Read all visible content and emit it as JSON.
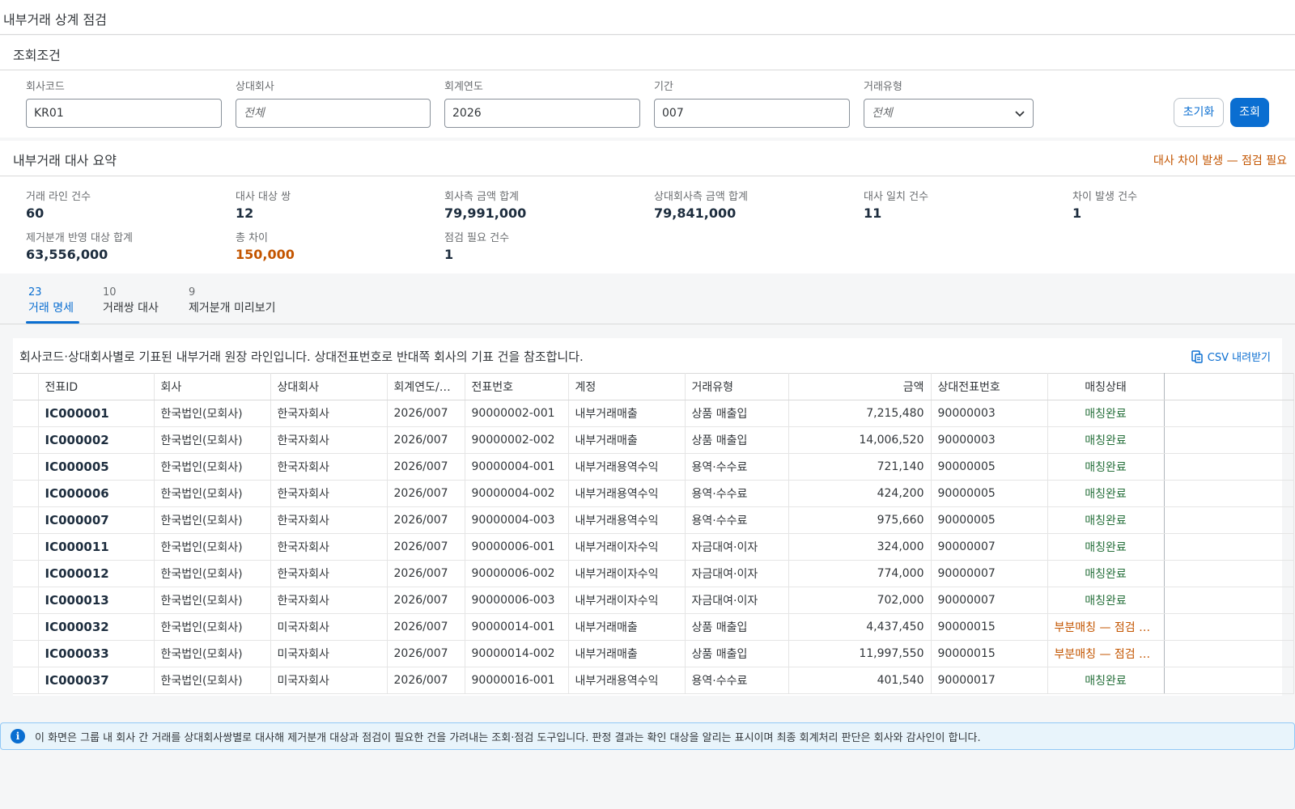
{
  "page": {
    "title": "내부거래 상계 점검"
  },
  "filter": {
    "title": "조회조건",
    "fields": [
      {
        "label": "회사코드",
        "value": "KR01",
        "placeholder": ""
      },
      {
        "label": "상대회사",
        "value": "",
        "placeholder": "전체"
      },
      {
        "label": "회계연도",
        "value": "2026",
        "placeholder": ""
      },
      {
        "label": "기간",
        "value": "007",
        "placeholder": ""
      },
      {
        "label": "거래유형",
        "value": "",
        "placeholder": "전체"
      }
    ],
    "reset_label": "초기화",
    "search_label": "조회"
  },
  "summary": {
    "title": "내부거래 대사 요약",
    "warning": "대사 차이 발생 — 점검 필요",
    "kpis": [
      {
        "label": "거래 라인 건수",
        "value": "60"
      },
      {
        "label": "대사 대상 쌍",
        "value": "12"
      },
      {
        "label": "회사측 금액 합계",
        "value": "79,991,000"
      },
      {
        "label": "상대회사측 금액 합계",
        "value": "79,841,000"
      },
      {
        "label": "대사 일치 건수",
        "value": "11"
      },
      {
        "label": "차이 발생 건수",
        "value": "1"
      },
      {
        "label": "제거분개 반영 대상 합계",
        "value": "63,556,000"
      },
      {
        "label": "총 차이",
        "value": "150,000"
      },
      {
        "label": "점검 필요 건수",
        "value": "1"
      }
    ]
  },
  "tabs": [
    {
      "count": "23",
      "label": "거래 명세"
    },
    {
      "count": "10",
      "label": "거래쌍 대사"
    },
    {
      "count": "9",
      "label": "제거분개 미리보기"
    }
  ],
  "table": {
    "description": "회사코드·상대회사별로 기표된 내부거래 원장 라인입니다. 상대전표번호로 반대쪽 회사의 기표 건을 참조합니다.",
    "csv_label": "CSV 내려받기",
    "columns": [
      "전표ID",
      "회사",
      "상대회사",
      "회계연도/기간",
      "전표번호",
      "계정",
      "거래유형",
      "금액",
      "상대전표번호",
      "매칭상태"
    ],
    "rows": [
      [
        "IC000001",
        "한국법인(모회사)",
        "한국자회사",
        "2026/007",
        "90000002-001",
        "내부거래매출",
        "상품 매출입",
        "7,215,480",
        "90000003",
        "매칭완료"
      ],
      [
        "IC000002",
        "한국법인(모회사)",
        "한국자회사",
        "2026/007",
        "90000002-002",
        "내부거래매출",
        "상품 매출입",
        "14,006,520",
        "90000003",
        "매칭완료"
      ],
      [
        "IC000005",
        "한국법인(모회사)",
        "한국자회사",
        "2026/007",
        "90000004-001",
        "내부거래용역수익",
        "용역·수수료",
        "721,140",
        "90000005",
        "매칭완료"
      ],
      [
        "IC000006",
        "한국법인(모회사)",
        "한국자회사",
        "2026/007",
        "90000004-002",
        "내부거래용역수익",
        "용역·수수료",
        "424,200",
        "90000005",
        "매칭완료"
      ],
      [
        "IC000007",
        "한국법인(모회사)",
        "한국자회사",
        "2026/007",
        "90000004-003",
        "내부거래용역수익",
        "용역·수수료",
        "975,660",
        "90000005",
        "매칭완료"
      ],
      [
        "IC000011",
        "한국법인(모회사)",
        "한국자회사",
        "2026/007",
        "90000006-001",
        "내부거래이자수익",
        "자금대여·이자",
        "324,000",
        "90000007",
        "매칭완료"
      ],
      [
        "IC000012",
        "한국법인(모회사)",
        "한국자회사",
        "2026/007",
        "90000006-002",
        "내부거래이자수익",
        "자금대여·이자",
        "774,000",
        "90000007",
        "매칭완료"
      ],
      [
        "IC000013",
        "한국법인(모회사)",
        "한국자회사",
        "2026/007",
        "90000006-003",
        "내부거래이자수익",
        "자금대여·이자",
        "702,000",
        "90000007",
        "매칭완료"
      ],
      [
        "IC000032",
        "한국법인(모회사)",
        "미국자회사",
        "2026/007",
        "90000014-001",
        "내부거래매출",
        "상품 매출입",
        "4,437,450",
        "90000015",
        "부분매칭 — 점검 필요"
      ],
      [
        "IC000033",
        "한국법인(모회사)",
        "미국자회사",
        "2026/007",
        "90000014-002",
        "내부거래매출",
        "상품 매출입",
        "11,997,550",
        "90000015",
        "부분매칭 — 점검 필요"
      ],
      [
        "IC000037",
        "한국법인(모회사)",
        "미국자회사",
        "2026/007",
        "90000016-001",
        "내부거래용역수익",
        "용역·수수료",
        "401,540",
        "90000017",
        "매칭완료"
      ]
    ]
  },
  "info": {
    "text": "이 화면은 그룹 내 회사 간 거래를 상대회사쌍별로 대사해 제거분개 대상과 점검이 필요한 건을 가려내는 조회·점검 도구입니다. 판정 결과는 확인 대상을 알리는 표시이며 최종 회계처리 판단은 회사와 감사인이 합니다."
  },
  "icons": {
    "select": "chevron-down-icon",
    "csv": "download-icon",
    "info": "info-icon"
  },
  "colors": {
    "accent": "#0a6ed1",
    "ok": "#256f3a",
    "warning": "#c35500"
  }
}
